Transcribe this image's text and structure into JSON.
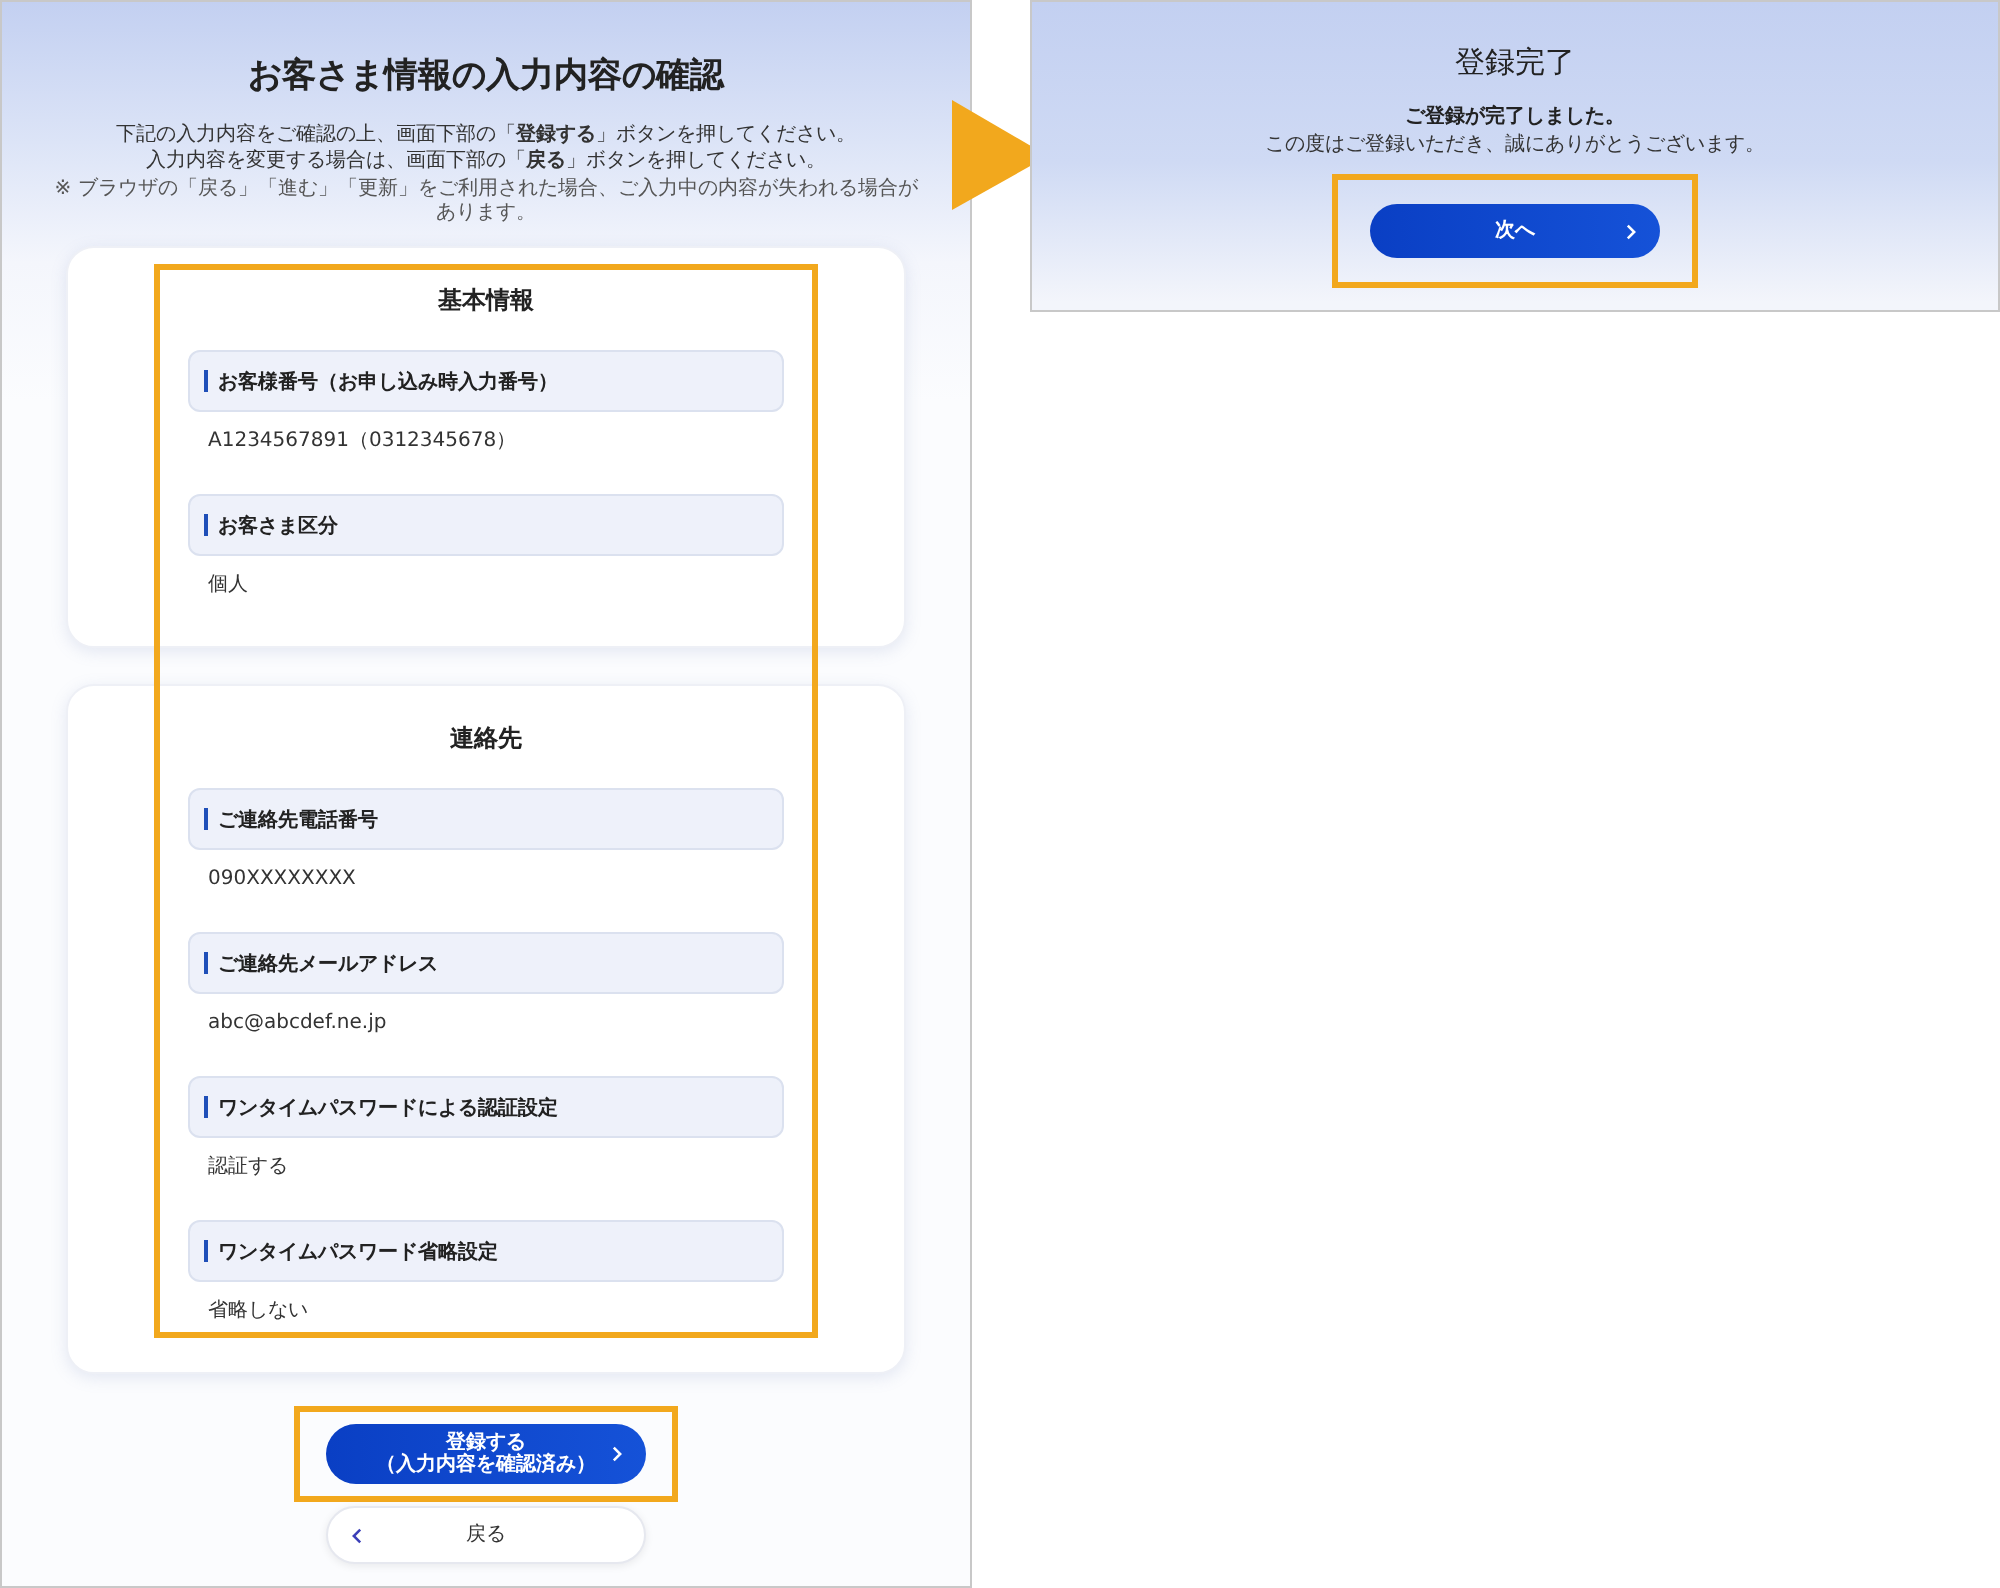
{
  "confirm_screen": {
    "title": "お客さま情報の入力内容の確認",
    "instructions": [
      "下記の入力内容をご確認の上、画面下部の「**登録する**」ボタンを押してください。",
      "入力内容を変更する場合は、画面下部の「**戻る**」ボタンを押してください。"
    ],
    "note": "※ ブラウザの「戻る」「進む」「更新」をご利用された場合、ご入力中の内容が失われる場合があります。",
    "sections": [
      {
        "heading": "基本情報",
        "fields": [
          {
            "label": "お客様番号（お申し込み時入力番号）",
            "value": "A1234567891（0312345678）"
          },
          {
            "label": "お客さま区分",
            "value": "個人"
          }
        ]
      },
      {
        "heading": "連絡先",
        "fields": [
          {
            "label": "ご連絡先電話番号",
            "value": "090XXXXXXXX"
          },
          {
            "label": "ご連絡先メールアドレス",
            "value": "abc@abcdef.ne.jp"
          },
          {
            "label": "ワンタイムパスワードによる認証設定",
            "value": "認証する"
          },
          {
            "label": "ワンタイムパスワード省略設定",
            "value": "省略しない"
          }
        ]
      }
    ],
    "buttons": [
      {
        "kind": "primary",
        "lines": [
          "登録する",
          "（入力内容を確認済み）"
        ]
      },
      {
        "kind": "secondary",
        "lines": [
          "戻る"
        ]
      }
    ]
  },
  "complete_screen": {
    "title": "登録完了",
    "message": "ご登録が完了しました。",
    "sub_message": "この度はご登録いただき、誠にありがとうございます。",
    "button": {
      "kind": "primary",
      "lines": [
        "次へ"
      ]
    }
  }
}
